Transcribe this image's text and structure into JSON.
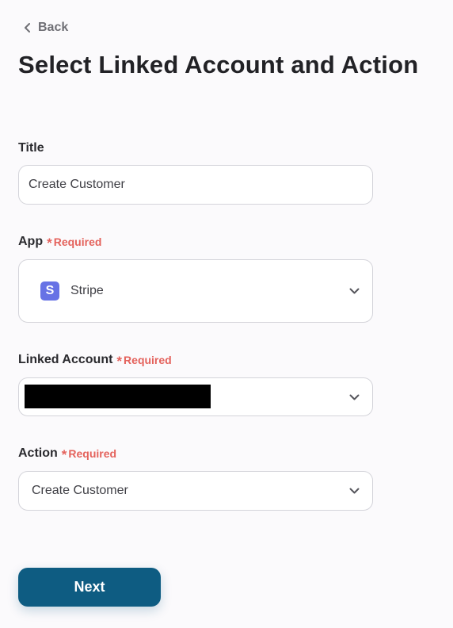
{
  "header": {
    "back_label": "Back",
    "page_title": "Select Linked Account and Action"
  },
  "form": {
    "title": {
      "label": "Title",
      "value": "Create Customer"
    },
    "app": {
      "label": "App",
      "required_label": "Required",
      "selected": "Stripe",
      "logo_letter": "S",
      "logo_color": "#6772e5"
    },
    "linked_account": {
      "label": "Linked Account",
      "required_label": "Required"
    },
    "action": {
      "label": "Action",
      "required_label": "Required",
      "selected": "Create Customer"
    }
  },
  "footer": {
    "next_label": "Next"
  },
  "icons": {
    "back": "chevron-left-icon",
    "select_arrow": "chevron-down-icon",
    "required_marker": "asterisk-icon"
  },
  "colors": {
    "primary_button": "#0e5c82",
    "required": "#e4625c",
    "background": "#fbfafc"
  }
}
